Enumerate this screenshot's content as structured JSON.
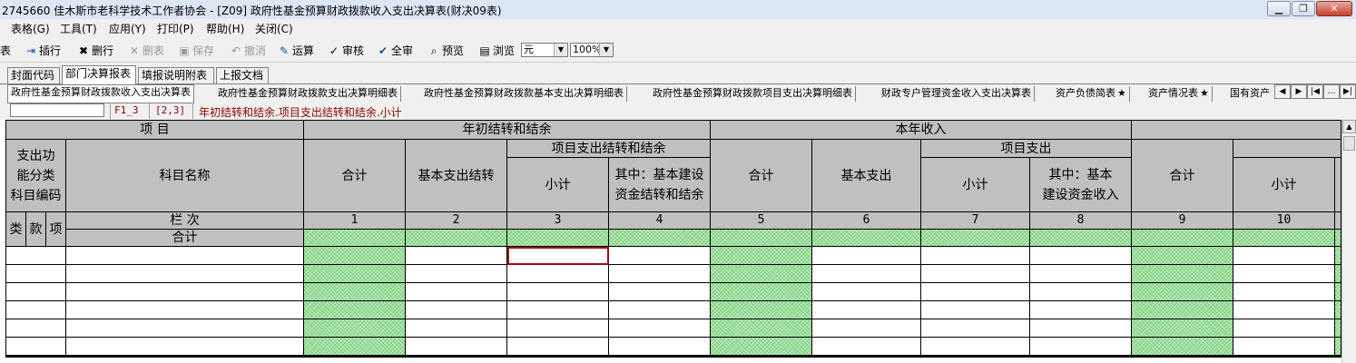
{
  "window": {
    "title": "2745660  佳木斯市老科学技术工作者协会 - [Z09] 政府性基金预算财政拨款收入支出决算表(财决09表)",
    "buttons": [
      "minimize",
      "restore",
      "close"
    ]
  },
  "menu": [
    "表格(G)",
    "工具(T)",
    "应用(Y)",
    "打印(P)",
    "帮助(H)",
    "关闭(C)"
  ],
  "toolbar": {
    "left_fragment": "表",
    "insert_row": "插行",
    "delete_row": "删行",
    "delete_table": "删表",
    "save": "保存",
    "undo": "撤消",
    "calculate": "运算",
    "review": "审核",
    "full_review": "全审",
    "preview": "预览",
    "browse": "浏览",
    "unit_value": "元",
    "zoom_value": "100%"
  },
  "tabs_main": [
    "封面代码",
    "部门决算报表",
    "填报说明附表",
    "上报文档"
  ],
  "tabs_main_active": 1,
  "tabs_sub": [
    {
      "label": "政府性基金预算财政拨款收入支出决算表",
      "star": false
    },
    {
      "label": "政府性基金预算财政拨款支出决算明细表",
      "star": false
    },
    {
      "label": "政府性基金预算财政拨款基本支出决算明细表",
      "star": false
    },
    {
      "label": "政府性基金预算财政拨款项目支出决算明细表",
      "star": false
    },
    {
      "label": "财政专户管理资金收入支出决算表",
      "star": false
    },
    {
      "label": "资产负债简表",
      "star": true
    },
    {
      "label": "资产情况表",
      "star": true
    },
    {
      "label": "国有资产",
      "star": false
    }
  ],
  "tabs_sub_active": 0,
  "nav_icons": [
    "tab-prev-icon",
    "tab-next-icon",
    "tab-first-icon",
    "tab-more-icon",
    "tab-last-icon"
  ],
  "info": {
    "cell_value": "",
    "sheet_ref": "F1_3",
    "coord": "[2,3]",
    "desc": "年初结转和结余.项目支出结转和结余.小计"
  },
  "sheet": {
    "h_item": "项    目",
    "h_begin": "年初结转和结余",
    "h_income": "本年收入",
    "h_func": "支出功\n能分类\n科目编码",
    "h_name": "科目名称",
    "h_proj_carry": "项目支出结转和结余",
    "h_proj_exp": "项目支出",
    "h_total_1": "合计",
    "h_basic_carry": "基本支出结转",
    "h_subtotal_1": "小计",
    "h_capital_carry": "其中：基本建设\n资金结转和结余",
    "h_total_2": "合计",
    "h_basic_exp": "基本支出",
    "h_subtotal_2": "小计",
    "h_capital_income": "其中：基本\n建设资金收入",
    "h_total_3": "合计",
    "h_subtotal_3": "小计",
    "h_lei": "类",
    "h_kuan": "款",
    "h_xiang": "项",
    "h_lanci": "栏      次",
    "h_heji_row": "合计",
    "col_nums": [
      "1",
      "2",
      "3",
      "4",
      "5",
      "6",
      "7",
      "8",
      "9",
      "10"
    ]
  },
  "colors": {
    "header_bg": "#c0c0c0",
    "formula_green": "#7ad07a",
    "selected_border": "#a01010",
    "info_text": "#8b0000"
  }
}
